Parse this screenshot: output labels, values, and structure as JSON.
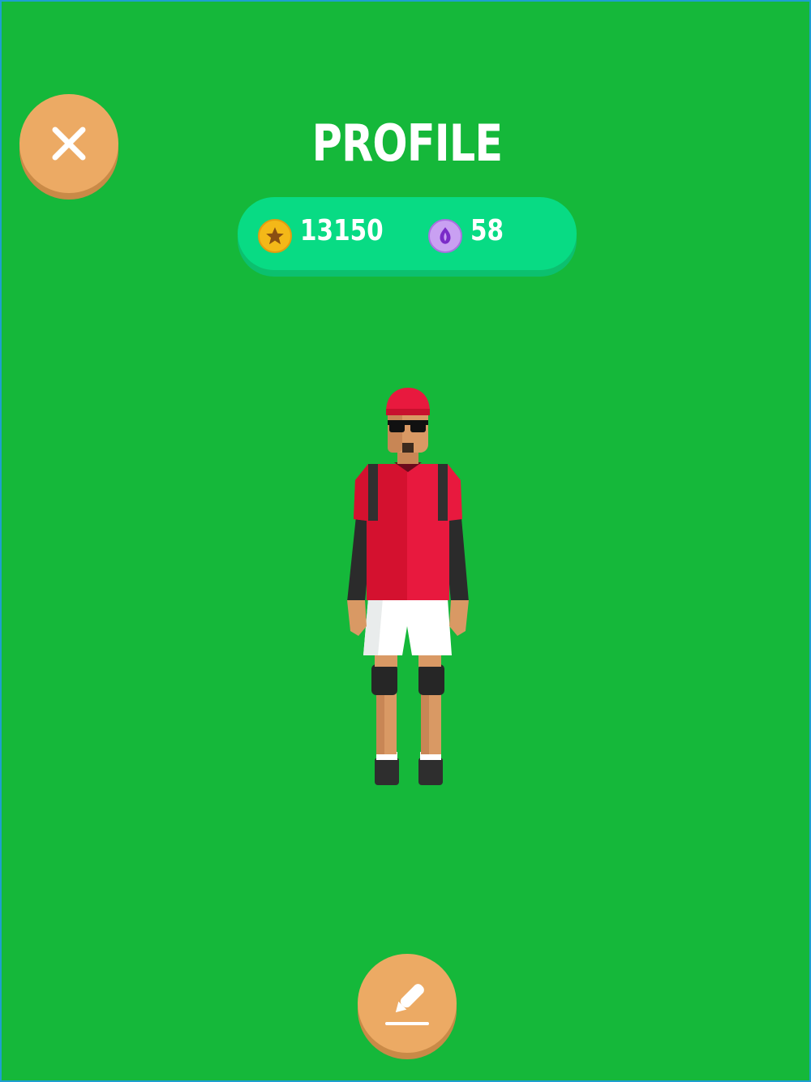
{
  "screen": {
    "title": "PROFILE",
    "background_color": "#15b83a"
  },
  "currency": {
    "coins": "13150",
    "gems": "58",
    "coin_icon": "star-coin-icon",
    "gem_icon": "purple-gem-icon"
  },
  "buttons": {
    "close_icon": "close-icon",
    "edit_icon": "pencil-icon",
    "accent_color": "#ecaa64"
  },
  "character": {
    "outfit": [
      "red cap",
      "sunglasses",
      "red shirt",
      "black sleeves",
      "white shorts",
      "knee pads",
      "dark shoes"
    ]
  }
}
